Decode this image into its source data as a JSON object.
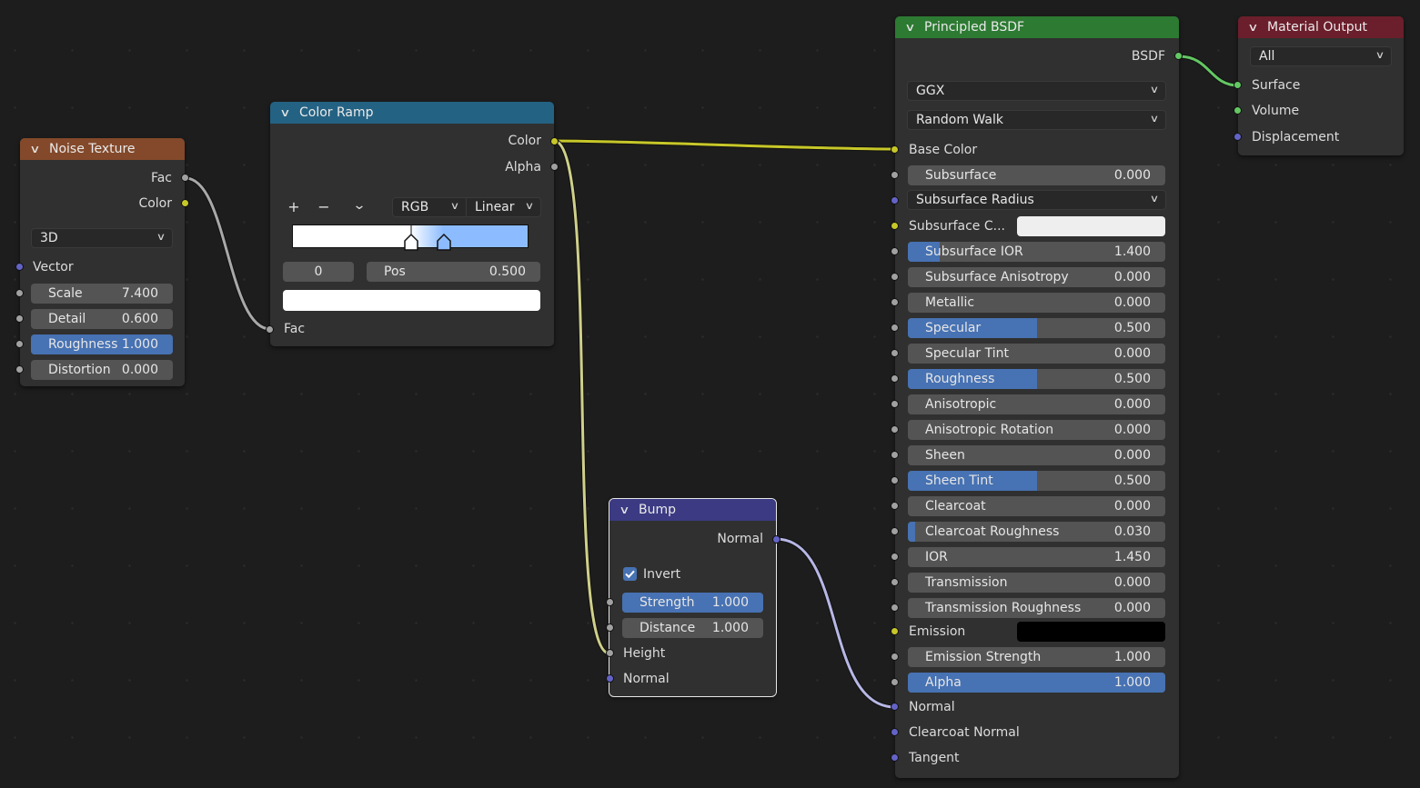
{
  "colors": {
    "yellow_socket": "#c7c729",
    "grey_socket": "#a1a1a1",
    "purple_socket": "#6363c7",
    "green_socket": "#63c763",
    "noise_header": "#83492a",
    "ramp_header": "#246283",
    "bsdf_header": "#2d7a33",
    "output_header": "#6b1e2b",
    "bump_header": "#3b3a83",
    "slider_fill": "#4772b3"
  },
  "noise": {
    "title": "Noise Texture",
    "out_fac": "Fac",
    "out_color": "Color",
    "dimension": "3D",
    "vector": "Vector",
    "fields": [
      {
        "name": "Scale",
        "value": "7.400",
        "fill": 0
      },
      {
        "name": "Detail",
        "value": "0.600",
        "fill": 0
      },
      {
        "name": "Roughness",
        "value": "1.000",
        "fill": 1
      },
      {
        "name": "Distortion",
        "value": "0.000",
        "fill": 0
      }
    ]
  },
  "ramp": {
    "title": "Color Ramp",
    "out_color": "Color",
    "out_alpha": "Alpha",
    "add": "+",
    "remove": "−",
    "menu": "⌄",
    "color_mode": "RGB",
    "interpolation": "Linear",
    "stop_index": "0",
    "pos_label": "Pos",
    "pos_value": "0.500",
    "stops": [
      0.5,
      0.64
    ],
    "in_fac": "Fac"
  },
  "bump": {
    "title": "Bump",
    "out_normal": "Normal",
    "invert": "Invert",
    "invert_checked": true,
    "strength_name": "Strength",
    "strength_value": "1.000",
    "distance_name": "Distance",
    "distance_value": "1.000",
    "height": "Height",
    "normal": "Normal"
  },
  "bsdf": {
    "title": "Principled BSDF",
    "out": "BSDF",
    "distribution": "GGX",
    "subsurface_method": "Random Walk",
    "base_color": "Base Color",
    "subsurface": {
      "name": "Subsurface",
      "value": "0.000"
    },
    "subsurface_radius": "Subsurface Radius",
    "subsurface_color": "Subsurface C...",
    "fields": [
      {
        "name": "Subsurface IOR",
        "value": "1.400",
        "fill": 0.125,
        "socket": "grey"
      },
      {
        "name": "Subsurface Anisotropy",
        "value": "0.000",
        "fill": 0,
        "socket": "grey"
      },
      {
        "name": "Metallic",
        "value": "0.000",
        "fill": 0,
        "socket": "grey"
      },
      {
        "name": "Specular",
        "value": "0.500",
        "fill": 0.5,
        "socket": "grey"
      },
      {
        "name": "Specular Tint",
        "value": "0.000",
        "fill": 0,
        "socket": "grey"
      },
      {
        "name": "Roughness",
        "value": "0.500",
        "fill": 0.5,
        "socket": "grey"
      },
      {
        "name": "Anisotropic",
        "value": "0.000",
        "fill": 0,
        "socket": "grey"
      },
      {
        "name": "Anisotropic Rotation",
        "value": "0.000",
        "fill": 0,
        "socket": "grey"
      },
      {
        "name": "Sheen",
        "value": "0.000",
        "fill": 0,
        "socket": "grey"
      },
      {
        "name": "Sheen Tint",
        "value": "0.500",
        "fill": 0.5,
        "socket": "grey"
      },
      {
        "name": "Clearcoat",
        "value": "0.000",
        "fill": 0,
        "socket": "grey"
      },
      {
        "name": "Clearcoat Roughness",
        "value": "0.030",
        "fill": 0.03,
        "socket": "grey"
      },
      {
        "name": "IOR",
        "value": "1.450",
        "fill": 0,
        "socket": "grey"
      },
      {
        "name": "Transmission",
        "value": "0.000",
        "fill": 0,
        "socket": "grey"
      },
      {
        "name": "Transmission Roughness",
        "value": "0.000",
        "fill": 0,
        "socket": "grey"
      }
    ],
    "emission": "Emission",
    "emission_strength": {
      "name": "Emission Strength",
      "value": "1.000"
    },
    "alpha": {
      "name": "Alpha",
      "value": "1.000",
      "fill": 1
    },
    "normal": "Normal",
    "clearcoat_normal": "Clearcoat Normal",
    "tangent": "Tangent"
  },
  "output": {
    "title": "Material Output",
    "target": "All",
    "surface": "Surface",
    "volume": "Volume",
    "displacement": "Displacement"
  }
}
